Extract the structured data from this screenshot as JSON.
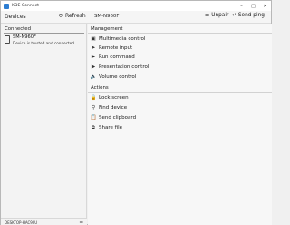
{
  "window": {
    "title": "KDE Connect"
  },
  "toolbar": {
    "devices_label": "Devices",
    "refresh_label": "Refresh",
    "current_device": "SM-N960F",
    "unpair_label": "Unpair",
    "send_ping_label": "Send ping"
  },
  "sidebar": {
    "section": "Connected",
    "devices": [
      {
        "name": "SM-N960F",
        "status": "Device is trusted and connected"
      }
    ],
    "host": "DESKTOP-HAC9IIU"
  },
  "management": {
    "heading": "Management",
    "items": [
      {
        "label": "Multimedia control",
        "icon": "multimedia-icon"
      },
      {
        "label": "Remote input",
        "icon": "cursor-icon"
      },
      {
        "label": "Run command",
        "icon": "terminal-icon"
      },
      {
        "label": "Presentation control",
        "icon": "pointer-icon"
      },
      {
        "label": "Volume control",
        "icon": "speaker-icon"
      }
    ]
  },
  "actions": {
    "heading": "Actions",
    "items": [
      {
        "label": "Lock screen",
        "icon": "lock-icon"
      },
      {
        "label": "Find device",
        "icon": "search-icon"
      },
      {
        "label": "Send clipboard",
        "icon": "clipboard-icon"
      },
      {
        "label": "Share file",
        "icon": "share-icon"
      }
    ]
  }
}
